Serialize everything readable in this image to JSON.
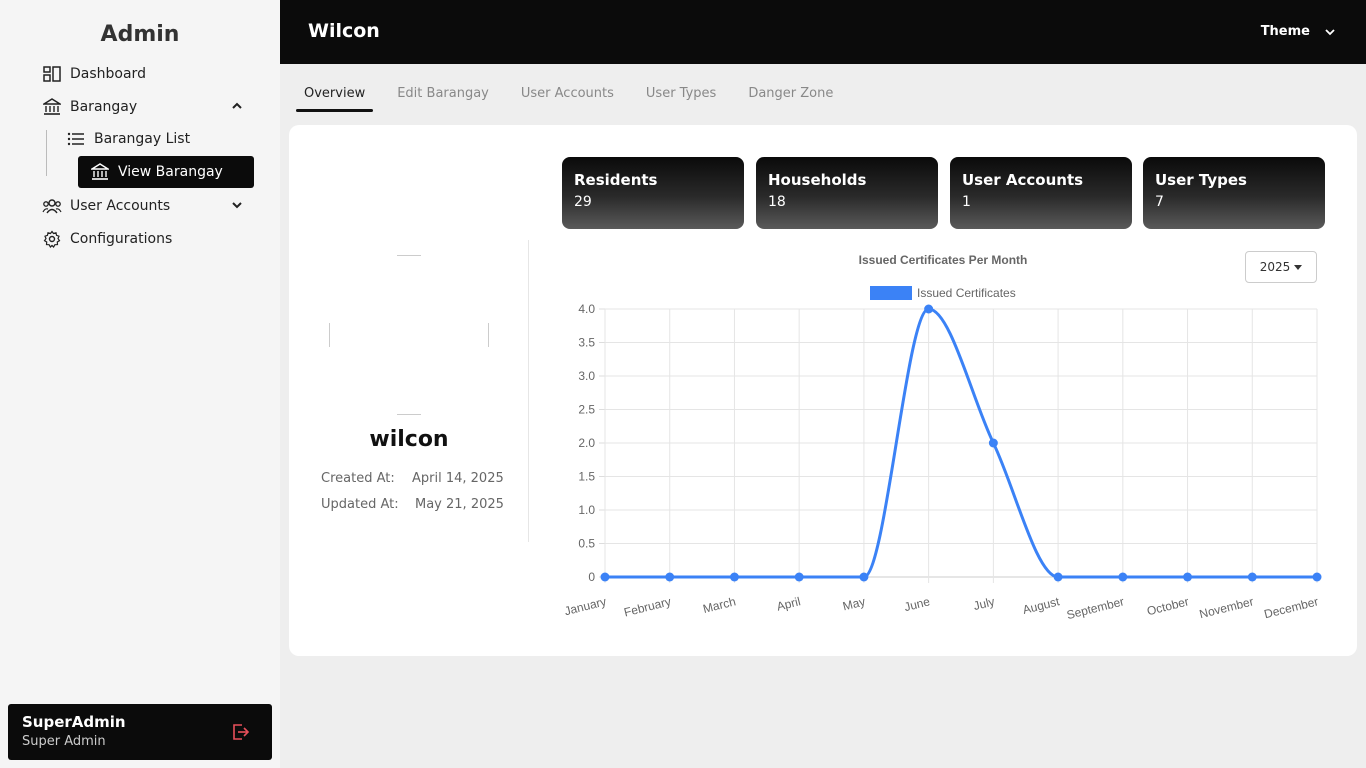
{
  "sidebar": {
    "brand": "Admin",
    "items": [
      {
        "label": "Dashboard",
        "icon": "dashboard-icon"
      },
      {
        "label": "Barangay",
        "icon": "bank-icon"
      },
      {
        "label": "User Accounts",
        "icon": "users-icon"
      },
      {
        "label": "Configurations",
        "icon": "gear-icon"
      }
    ],
    "sub_items": [
      {
        "label": "Barangay List",
        "icon": "list-icon"
      },
      {
        "label": "View Barangay",
        "icon": "bank-icon"
      }
    ],
    "user": {
      "name": "SuperAdmin",
      "role": "Super Admin"
    }
  },
  "topbar": {
    "title": "Wilcon",
    "theme_label": "Theme"
  },
  "tabs": [
    "Overview",
    "Edit Barangay",
    "User Accounts",
    "User Types",
    "Danger Zone"
  ],
  "profile": {
    "name": "wilcon",
    "created_label": "Created At:",
    "created_value": "April 14, 2025",
    "updated_label": "Updated At:",
    "updated_value": "May 21, 2025"
  },
  "stats": [
    {
      "label": "Residents",
      "value": "29"
    },
    {
      "label": "Households",
      "value": "18"
    },
    {
      "label": "User Accounts",
      "value": "1"
    },
    {
      "label": "User Types",
      "value": "7"
    }
  ],
  "year_select": "2025",
  "colors": {
    "accent": "#3b82f6",
    "dark": "#0b0b0b",
    "logout": "#e8505b"
  },
  "chart_data": {
    "type": "line",
    "title": "Issued Certificates Per Month",
    "categories": [
      "January",
      "February",
      "March",
      "April",
      "May",
      "June",
      "July",
      "August",
      "September",
      "October",
      "November",
      "December"
    ],
    "series": [
      {
        "name": "Issued Certificates",
        "values": [
          0,
          0,
          0,
          0,
          0,
          4,
          2,
          0,
          0,
          0,
          0,
          0
        ]
      }
    ],
    "ylim": [
      0,
      4
    ],
    "yticks": [
      "0",
      "0.5",
      "1.0",
      "1.5",
      "2.0",
      "2.5",
      "3.0",
      "3.5",
      "4.0"
    ],
    "ytick_values": [
      0,
      0.5,
      1,
      1.5,
      2,
      2.5,
      3,
      3.5,
      4
    ],
    "legend": "top",
    "grid": true
  }
}
